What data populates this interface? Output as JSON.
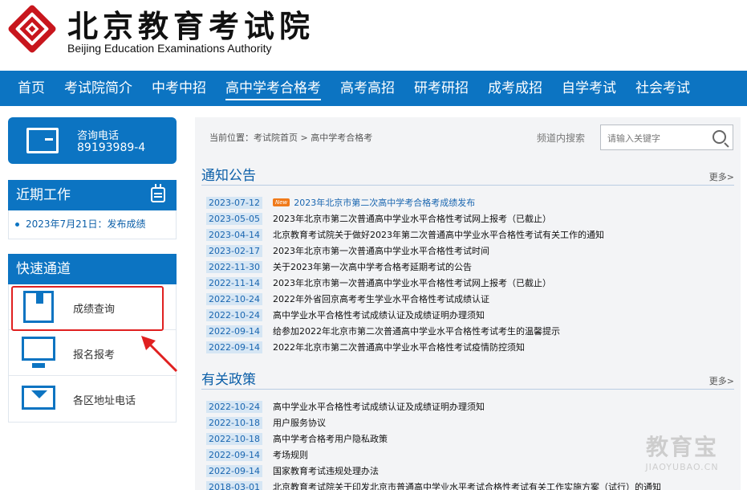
{
  "header": {
    "logo_icon": "bjeea-emblem-icon",
    "title": "北京教育考试院",
    "subtitle": "Beijing Education Examinations Authority"
  },
  "nav": {
    "items": [
      {
        "label": "首页",
        "active": false
      },
      {
        "label": "考试院简介",
        "active": false
      },
      {
        "label": "中考中招",
        "active": false
      },
      {
        "label": "高中学考合格考",
        "active": true
      },
      {
        "label": "高考高招",
        "active": false
      },
      {
        "label": "研考研招",
        "active": false
      },
      {
        "label": "成考成招",
        "active": false
      },
      {
        "label": "自学考试",
        "active": false
      },
      {
        "label": "社会考试",
        "active": false
      }
    ]
  },
  "sidebar": {
    "phone": {
      "label": "咨询电话",
      "number": "89193989-4",
      "icon": "phone-card-icon"
    },
    "recent": {
      "title": "近期工作",
      "icon": "calendar-icon",
      "items": [
        "2023年7月21日：发布成绩"
      ]
    },
    "quick": {
      "title": "快速通道",
      "items": [
        {
          "label": "成绩查询",
          "icon": "bookmark-book-icon"
        },
        {
          "label": "报名报考",
          "icon": "monitor-icon"
        },
        {
          "label": "各区地址电话",
          "icon": "envelope-icon"
        }
      ]
    }
  },
  "main": {
    "breadcrumb": "当前位置：考试院首页 > 高中学考合格考",
    "search": {
      "label": "频道内搜索",
      "placeholder": "请输入关键字"
    },
    "notice": {
      "title": "通知公告",
      "more": "更多>",
      "items": [
        {
          "date": "2023-07-12",
          "title": "2023年北京市第二次高中学考合格考成绩发布",
          "badge": "New",
          "highlight": true
        },
        {
          "date": "2023-05-05",
          "title": "2023年北京市第二次普通高中学业水平合格性考试网上报考（已截止）"
        },
        {
          "date": "2023-04-14",
          "title": "北京教育考试院关于做好2023年第二次普通高中学业水平合格性考试有关工作的通知"
        },
        {
          "date": "2023-02-17",
          "title": "2023年北京市第一次普通高中学业水平合格性考试时间"
        },
        {
          "date": "2022-11-30",
          "title": "关于2023年第一次高中学考合格考延期考试的公告"
        },
        {
          "date": "2022-11-14",
          "title": "2023年北京市第一次普通高中学业水平合格性考试网上报考（已截止）"
        },
        {
          "date": "2022-10-24",
          "title": "2022年外省回京高考考生学业水平合格性考试成绩认证"
        },
        {
          "date": "2022-10-24",
          "title": "高中学业水平合格性考试成绩认证及成绩证明办理须知"
        },
        {
          "date": "2022-09-14",
          "title": "给参加2022年北京市第二次普通高中学业水平合格性考试考生的温馨提示"
        },
        {
          "date": "2022-09-14",
          "title": "2022年北京市第二次普通高中学业水平合格性考试疫情防控须知"
        }
      ]
    },
    "policy": {
      "title": "有关政策",
      "more": "更多>",
      "items": [
        {
          "date": "2022-10-24",
          "title": "高中学业水平合格性考试成绩认证及成绩证明办理须知"
        },
        {
          "date": "2022-10-18",
          "title": "用户服务协议"
        },
        {
          "date": "2022-10-18",
          "title": "高中学考合格考用户隐私政策"
        },
        {
          "date": "2022-09-14",
          "title": "考场规则"
        },
        {
          "date": "2022-09-14",
          "title": "国家教育考试违规处理办法"
        },
        {
          "date": "2018-03-01",
          "title": "北京教育考试院关于印发北京市普通高中学业水平考试合格性考试有关工作实施方案（试行）的通知"
        }
      ]
    }
  },
  "watermark": {
    "main": "教育宝",
    "sub": "JIAOYUBAO.CN"
  },
  "colors": {
    "brand": "#0c74c2",
    "date_bg": "#d6e6f4",
    "badge": "#f07a1a",
    "annotation": "#e02020"
  }
}
